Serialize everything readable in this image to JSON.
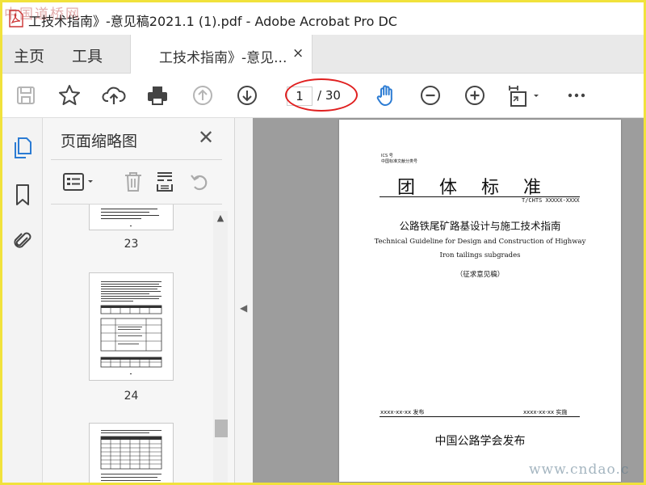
{
  "window": {
    "title": "工技术指南》-意见稿2021.1 (1).pdf - Adobe Acrobat Pro DC",
    "watermark_top": "中国道桥网",
    "watermark_bottom": "www.cndao.c"
  },
  "menu": {
    "home": "主页",
    "tools": "工具",
    "doc_tab": "工技术指南》-意见...",
    "doc_tab_close": "×"
  },
  "toolbar": {
    "icons": [
      "save-icon",
      "star-icon",
      "upload-icon",
      "print-icon",
      "page-up-icon",
      "page-down-icon",
      "hand-icon",
      "zoom-out-icon",
      "zoom-in-icon",
      "fit-page-icon",
      "more-icon"
    ],
    "page_current": "1",
    "page_total": "/ 30",
    "accent_color": "#2b7bd3",
    "highlight_color": "#e02020"
  },
  "left_panel": {
    "title": "页面缩略图",
    "close": "✕",
    "rail_icons": [
      "pages-icon",
      "bookmark-icon",
      "attachment-icon"
    ],
    "tool_icons": [
      "options-icon",
      "delete-icon",
      "extract-icon",
      "undo-icon"
    ],
    "thumbnails": [
      {
        "label": "23"
      },
      {
        "label": "24"
      },
      {
        "label": ""
      }
    ]
  },
  "pdf_page": {
    "ics": "ICS 号",
    "classification": "中国标准文献分类号",
    "heading": "团体标准",
    "std_number": "T/CHTS XXXXX-XXXX",
    "title_cn": "公路铁尾矿路基设计与施工技术指南",
    "title_en_line1": "Technical Guideline for Design and Construction of Highway",
    "title_en_line2": "Iron tailings subgrades",
    "draft_note": "（征求意见稿）",
    "issue_date": "xxxx-xx-xx 发布",
    "impl_date": "xxxx-xx-xx 实施",
    "publisher": "中国公路学会发布"
  }
}
